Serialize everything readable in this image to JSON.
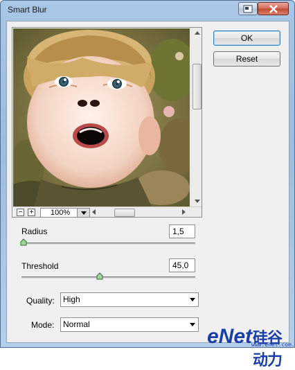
{
  "window": {
    "title": "Smart Blur"
  },
  "preview": {
    "zoom": "100%"
  },
  "buttons": {
    "ok": "OK",
    "reset": "Reset"
  },
  "radius": {
    "label": "Radius",
    "value": "1,5",
    "level_percent": 1.5
  },
  "threshold": {
    "label": "Threshold",
    "value": "45,0",
    "level_percent": 45
  },
  "quality": {
    "label": "Quality:",
    "value": "High"
  },
  "mode": {
    "label": "Mode:",
    "value": "Normal"
  },
  "watermark": {
    "brand": "eNet",
    "cn": "硅谷动力",
    "url": "www.enet.com.cn"
  }
}
